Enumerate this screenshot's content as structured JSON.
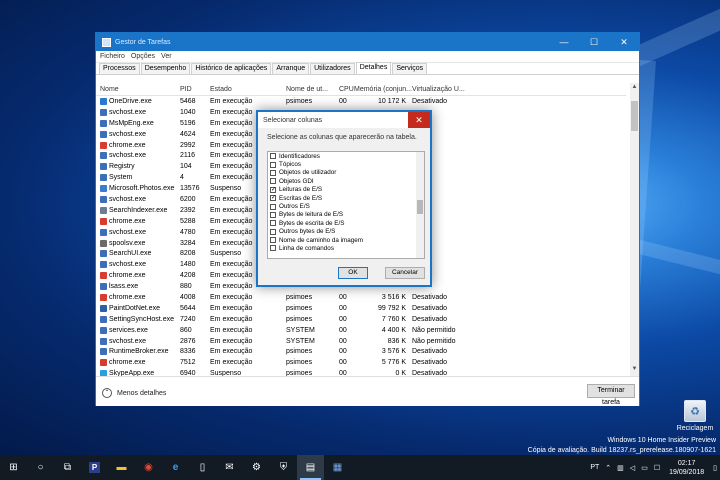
{
  "window": {
    "title": "Gestor de Tarefas",
    "menu": [
      "Ficheiro",
      "Opções",
      "Ver"
    ],
    "tabs": [
      "Processos",
      "Desempenho",
      "Histórico de aplicações",
      "Arranque",
      "Utilizadores",
      "Detalhes",
      "Serviços"
    ],
    "active_tab": "Detalhes",
    "columns": [
      "Nome",
      "PID",
      "Estado",
      "Nome de ut...",
      "CPU",
      "Memória (conjun...",
      "Virtualização U..."
    ],
    "rows": [
      {
        "name": "OneDrive.exe",
        "pid": "5468",
        "status": "Em execução",
        "user": "psimoes",
        "cpu": "00",
        "mem": "10 172 K",
        "virt": "Desativado",
        "icon": "onedrive",
        "color": "#2b78d1"
      },
      {
        "name": "svchost.exe",
        "pid": "1040",
        "status": "Em execução",
        "user": "",
        "cpu": "",
        "mem": "",
        "virt": "",
        "icon": "service",
        "color": "#3d6fb8"
      },
      {
        "name": "MsMpEng.exe",
        "pid": "5196",
        "status": "Em execução",
        "user": "",
        "cpu": "",
        "mem": "",
        "virt": "",
        "icon": "service",
        "color": "#3d6fb8"
      },
      {
        "name": "svchost.exe",
        "pid": "4624",
        "status": "Em execução",
        "user": "",
        "cpu": "",
        "mem": "",
        "virt": "",
        "icon": "service",
        "color": "#3d6fb8"
      },
      {
        "name": "chrome.exe",
        "pid": "2992",
        "status": "Em execução",
        "user": "",
        "cpu": "",
        "mem": "",
        "virt": "",
        "icon": "chrome",
        "color": "#d93b2e"
      },
      {
        "name": "svchost.exe",
        "pid": "2116",
        "status": "Em execução",
        "user": "",
        "cpu": "",
        "mem": "",
        "virt": "",
        "icon": "service",
        "color": "#3d6fb8"
      },
      {
        "name": "Registry",
        "pid": "104",
        "status": "Em execução",
        "user": "",
        "cpu": "",
        "mem": "",
        "virt": "",
        "icon": "service",
        "color": "#3d6fb8"
      },
      {
        "name": "System",
        "pid": "4",
        "status": "Em execução",
        "user": "",
        "cpu": "",
        "mem": "",
        "virt": "",
        "icon": "service",
        "color": "#3d6fb8"
      },
      {
        "name": "Microsoft.Photos.exe",
        "pid": "13576",
        "status": "Suspenso",
        "user": "",
        "cpu": "",
        "mem": "",
        "virt": "",
        "icon": "photos",
        "color": "#3b7bd0"
      },
      {
        "name": "svchost.exe",
        "pid": "6200",
        "status": "Em execução",
        "user": "",
        "cpu": "",
        "mem": "",
        "virt": "",
        "icon": "service",
        "color": "#3d6fb8"
      },
      {
        "name": "SearchIndexer.exe",
        "pid": "2392",
        "status": "Em execução",
        "user": "",
        "cpu": "",
        "mem": "",
        "virt": "",
        "icon": "search",
        "color": "#6a7d91"
      },
      {
        "name": "chrome.exe",
        "pid": "5288",
        "status": "Em execução",
        "user": "",
        "cpu": "",
        "mem": "",
        "virt": "",
        "icon": "chrome",
        "color": "#d93b2e"
      },
      {
        "name": "svchost.exe",
        "pid": "4780",
        "status": "Em execução",
        "user": "",
        "cpu": "",
        "mem": "",
        "virt": "",
        "icon": "service",
        "color": "#3d6fb8"
      },
      {
        "name": "spoolsv.exe",
        "pid": "3284",
        "status": "Em execução",
        "user": "",
        "cpu": "",
        "mem": "",
        "virt": "",
        "icon": "printer",
        "color": "#6b6b6b"
      },
      {
        "name": "SearchUI.exe",
        "pid": "8208",
        "status": "Suspenso",
        "user": "",
        "cpu": "",
        "mem": "",
        "virt": "",
        "icon": "service",
        "color": "#3d6fb8"
      },
      {
        "name": "svchost.exe",
        "pid": "1480",
        "status": "Em execução",
        "user": "",
        "cpu": "",
        "mem": "",
        "virt": "",
        "icon": "service",
        "color": "#3d6fb8"
      },
      {
        "name": "chrome.exe",
        "pid": "4208",
        "status": "Em execução",
        "user": "",
        "cpu": "",
        "mem": "",
        "virt": "",
        "icon": "chrome",
        "color": "#d93b2e"
      },
      {
        "name": "lsass.exe",
        "pid": "880",
        "status": "Em execução",
        "user": "",
        "cpu": "",
        "mem": "",
        "virt": "",
        "icon": "service",
        "color": "#3d6fb8"
      },
      {
        "name": "chrome.exe",
        "pid": "4008",
        "status": "Em execução",
        "user": "psimoes",
        "cpu": "00",
        "mem": "3 516 K",
        "virt": "Desativado",
        "icon": "chrome",
        "color": "#d93b2e"
      },
      {
        "name": "PaintDotNet.exe",
        "pid": "5644",
        "status": "Em execução",
        "user": "psimoes",
        "cpu": "00",
        "mem": "99 792 K",
        "virt": "Desativado",
        "icon": "paint",
        "color": "#2d5fa8"
      },
      {
        "name": "SettingSyncHost.exe",
        "pid": "7240",
        "status": "Em execução",
        "user": "psimoes",
        "cpu": "00",
        "mem": "7 760 K",
        "virt": "Desativado",
        "icon": "service",
        "color": "#3d6fb8"
      },
      {
        "name": "services.exe",
        "pid": "860",
        "status": "Em execução",
        "user": "SYSTEM",
        "cpu": "00",
        "mem": "4 400 K",
        "virt": "Não permitido",
        "icon": "service",
        "color": "#3d6fb8"
      },
      {
        "name": "svchost.exe",
        "pid": "2876",
        "status": "Em execução",
        "user": "SYSTEM",
        "cpu": "00",
        "mem": "836 K",
        "virt": "Não permitido",
        "icon": "service",
        "color": "#3d6fb8"
      },
      {
        "name": "RuntimeBroker.exe",
        "pid": "8336",
        "status": "Em execução",
        "user": "psimoes",
        "cpu": "00",
        "mem": "3 576 K",
        "virt": "Desativado",
        "icon": "service",
        "color": "#3d6fb8"
      },
      {
        "name": "chrome.exe",
        "pid": "7512",
        "status": "Em execução",
        "user": "psimoes",
        "cpu": "00",
        "mem": "5 776 K",
        "virt": "Desativado",
        "icon": "chrome",
        "color": "#d93b2e"
      },
      {
        "name": "SkypeApp.exe",
        "pid": "6940",
        "status": "Suspenso",
        "user": "psimoes",
        "cpu": "00",
        "mem": "0 K",
        "virt": "Desativado",
        "icon": "skype",
        "color": "#2a9fe0"
      }
    ],
    "partial_right": [
      {
        "user": "SYSTEM",
        "virt": "Não permitido"
      },
      {
        "user": "",
        "virt": "ermitido"
      },
      {
        "user": "",
        "virt": "ermitido"
      },
      {
        "user": "",
        "virt": "ermitido"
      },
      {
        "user": "",
        "virt": "ivado"
      },
      {
        "user": "",
        "virt": "ermitido"
      },
      {
        "user": "",
        "virt": "ermitido"
      },
      {
        "user": "",
        "virt": "ermitido"
      },
      {
        "user": "",
        "virt": "ivado"
      },
      {
        "user": "",
        "virt": "ermitido"
      },
      {
        "user": "",
        "virt": "ermitido"
      },
      {
        "user": "",
        "virt": "ivado"
      },
      {
        "user": "",
        "virt": "ermitido"
      },
      {
        "user": "",
        "virt": "ermitido"
      },
      {
        "user": "",
        "virt": "ivado"
      },
      {
        "user": "",
        "virt": "ermitido"
      },
      {
        "user": "",
        "virt": "ivado"
      },
      {
        "user": "",
        "virt": "ermitido"
      }
    ],
    "fewer_details": "Menos detalhes",
    "end_task": "Terminar tarefa"
  },
  "dialog": {
    "title": "Selecionar colunas",
    "description": "Selecione as colunas que aparecerão na tabela.",
    "items": [
      {
        "label": "Identificadores",
        "checked": false
      },
      {
        "label": "Tópicos",
        "checked": false
      },
      {
        "label": "Objetos de utilizador",
        "checked": false
      },
      {
        "label": "Objetos GDI",
        "checked": false
      },
      {
        "label": "Leituras de E/S",
        "checked": true
      },
      {
        "label": "Escritas de E/S",
        "checked": true
      },
      {
        "label": "Outros E/S",
        "checked": false
      },
      {
        "label": "Bytes de leitura de E/S",
        "checked": false
      },
      {
        "label": "Bytes de escrita de E/S",
        "checked": false
      },
      {
        "label": "Outros bytes de E/S",
        "checked": false
      },
      {
        "label": "Nome de caminho da imagem",
        "checked": false
      },
      {
        "label": "Linha de comandos",
        "checked": false
      }
    ],
    "ok": "OK",
    "cancel": "Cancelar"
  },
  "desktop": {
    "recycle_bin": "Reciclagem",
    "watermark_line1": "Windows 10 Home Insider Preview",
    "watermark_line2": "Cópia de avaliação. Build 18237.rs_prerelease.180907-1621"
  },
  "taskbar": {
    "apps": [
      "start-icon",
      "search-icon",
      "task-view-icon",
      "app-p-icon",
      "file-explorer-icon",
      "chrome-icon",
      "edge-icon",
      "phone-icon",
      "mail-icon",
      "settings-icon",
      "security-icon",
      "task-manager-icon",
      "paint-icon"
    ],
    "language": "PT",
    "time": "02:17",
    "date": "19/09/2018"
  }
}
